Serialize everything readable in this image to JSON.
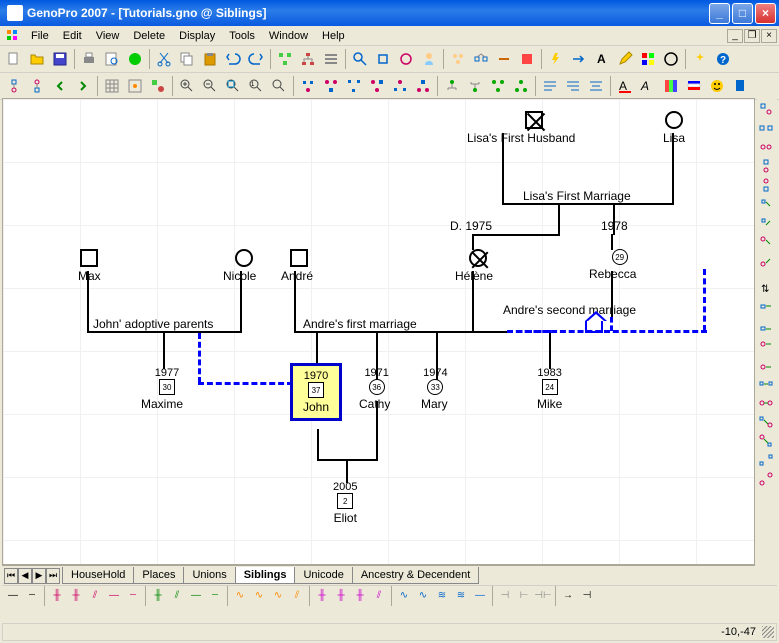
{
  "window": {
    "title": "GenoPro 2007 - [Tutorials.gno @ Siblings]"
  },
  "menu": [
    "File",
    "Edit",
    "View",
    "Delete",
    "Display",
    "Tools",
    "Window",
    "Help"
  ],
  "tabs": {
    "items": [
      "HouseHold",
      "Places",
      "Unions",
      "Siblings",
      "Unicode",
      "Ancestry & Decendent"
    ],
    "active": "Siblings"
  },
  "status": {
    "coords": "-10,-47"
  },
  "people": {
    "lisaHusband": {
      "name": "Lisa's First Husband"
    },
    "lisa": {
      "name": "Lisa"
    },
    "max": {
      "name": "Max"
    },
    "nicole": {
      "name": "Nicole"
    },
    "andre": {
      "name": "André"
    },
    "helene": {
      "name": "Hélène",
      "death": "D. 1975"
    },
    "rebecca": {
      "name": "Rebecca",
      "age": "29"
    },
    "maxime": {
      "name": "Maxime",
      "year": "1977",
      "age": "30"
    },
    "john": {
      "name": "John",
      "year": "1970",
      "age": "37"
    },
    "cathy": {
      "name": "Cathy",
      "year": "1971",
      "age": "36"
    },
    "mary": {
      "name": "Mary",
      "year": "1974",
      "age": "33"
    },
    "mike": {
      "name": "Mike",
      "year": "1983",
      "age": "24"
    },
    "eliot": {
      "name": "Eliot",
      "year": "2005",
      "age": "2"
    }
  },
  "marriages": {
    "lisaFirst": {
      "label": "Lisa's First Marriage",
      "year": "1978"
    },
    "johnAdoptive": {
      "label": "John' adoptive parents"
    },
    "andreFirst": {
      "label": "Andre's first marriage"
    },
    "andreSecond": {
      "label": "Andre's second marriage"
    }
  }
}
